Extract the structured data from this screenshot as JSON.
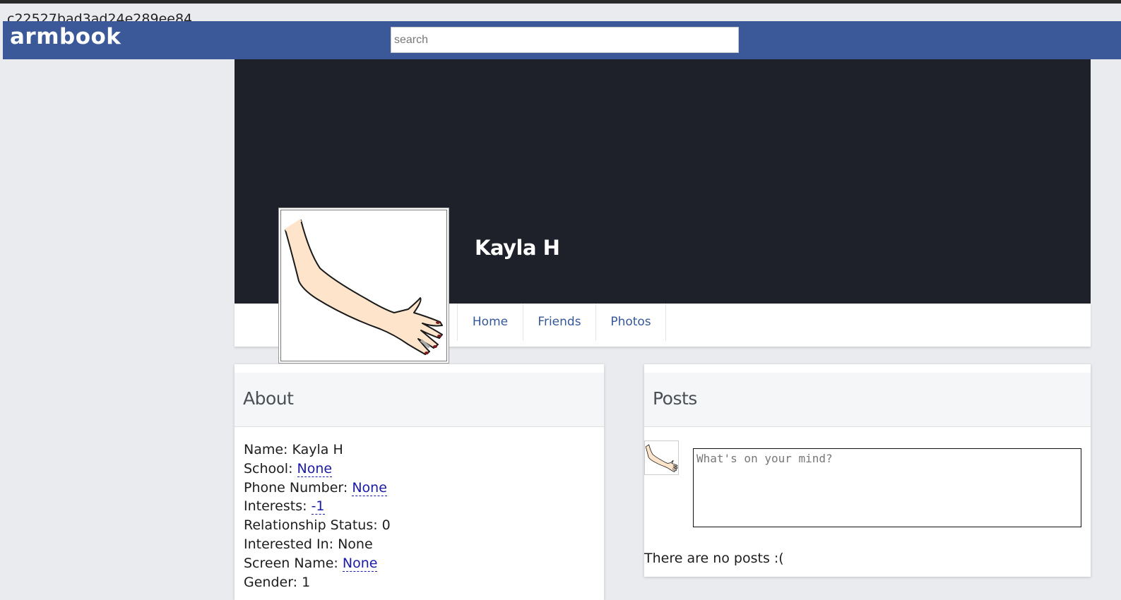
{
  "page": {
    "hash_text": "c22527bad3ad24e289ee84"
  },
  "navbar": {
    "logo": "armbook",
    "search_placeholder": "search",
    "background_color": "#3b5998"
  },
  "profile": {
    "name": "Kayla H",
    "avatar_icon": "arm-illustration",
    "cover_color": "#1e212a"
  },
  "tabs": [
    {
      "label": "Home"
    },
    {
      "label": "Friends"
    },
    {
      "label": "Photos"
    }
  ],
  "about": {
    "title": "About",
    "fields": [
      {
        "label": "Name: ",
        "value": "Kayla H"
      },
      {
        "label": "School: ",
        "value": "None"
      },
      {
        "label": "Phone Number: ",
        "value": "None"
      },
      {
        "label": "Interests: ",
        "value": "-1"
      },
      {
        "label": "Relationship Status: ",
        "value": "0"
      },
      {
        "label": "Interested In: ",
        "value": "None"
      },
      {
        "label": "Screen Name: ",
        "value": "None"
      },
      {
        "label": "Gender: ",
        "value": "1"
      }
    ]
  },
  "posts": {
    "title": "Posts",
    "composer_placeholder": "What's on your mind?",
    "empty_text": "There are no posts :("
  }
}
